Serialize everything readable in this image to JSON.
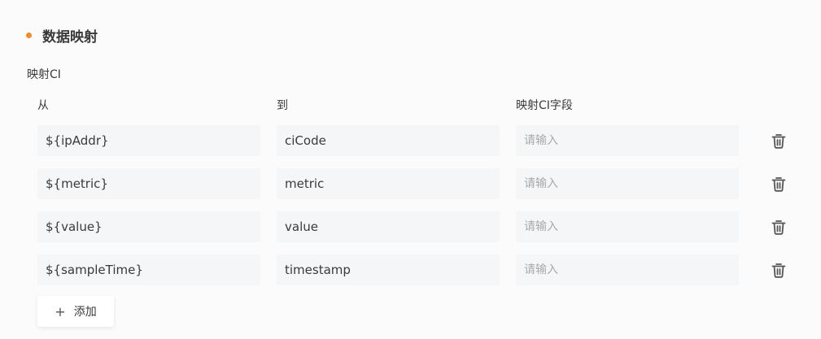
{
  "section": {
    "title": "数据映射",
    "accent_color": "#f28b2c"
  },
  "mapping_label": "映射CI",
  "columns": {
    "from": "从",
    "to": "到",
    "field": "映射CI字段"
  },
  "rows": [
    {
      "from": "${ipAddr}",
      "to": "ciCode",
      "field_value": "",
      "field_placeholder": "请输入"
    },
    {
      "from": "${metric}",
      "to": "metric",
      "field_value": "",
      "field_placeholder": "请输入"
    },
    {
      "from": "${value}",
      "to": "value",
      "field_value": "",
      "field_placeholder": "请输入"
    },
    {
      "from": "${sampleTime}",
      "to": "timestamp",
      "field_value": "",
      "field_placeholder": "请输入"
    }
  ],
  "delete_icon": "trash-icon",
  "add_button": {
    "icon": "plus-icon",
    "icon_glyph": "+",
    "label": "添加"
  }
}
